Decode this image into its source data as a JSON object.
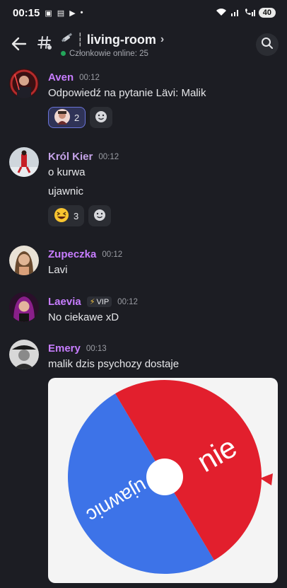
{
  "statusbar": {
    "time": "00:15",
    "battery": "40"
  },
  "header": {
    "channel_name": "living-room",
    "members_online": "Członkowie online: 25"
  },
  "messages": [
    {
      "user": "Aven",
      "time": "00:12",
      "name_color": "#c77dff",
      "lines": [
        "Odpowiedź na pytanie Lävi: Malik"
      ],
      "reactions": [
        {
          "emoji": "avatar-emoji",
          "count": "2",
          "selected": true
        }
      ]
    },
    {
      "user": "Król Kier",
      "time": "00:12",
      "name_color": "#c5a3e8",
      "lines": [
        "o kurwa",
        "ujawnic"
      ],
      "reactions": [
        {
          "emoji": "grin-squint-emoji",
          "count": "3",
          "selected": false
        }
      ]
    },
    {
      "user": "Zupeczka",
      "time": "00:12",
      "name_color": "#c77dff",
      "lines": [
        "Lavi"
      ]
    },
    {
      "user": "Laevia",
      "time": "00:12",
      "name_color": "#c77dff",
      "badge": "VIP",
      "lines": [
        "No ciekawe xD"
      ]
    },
    {
      "user": "Emery",
      "time": "00:13",
      "name_color": "#c77dff",
      "lines": [
        "malik dzis psychozy dostaje"
      ],
      "image": {
        "wheel_labels": [
          "nie",
          "ujawnic"
        ],
        "colors": {
          "red": "#e21f2d",
          "blue": "#3d73e8",
          "pointer": "#e0222e"
        }
      }
    }
  ]
}
